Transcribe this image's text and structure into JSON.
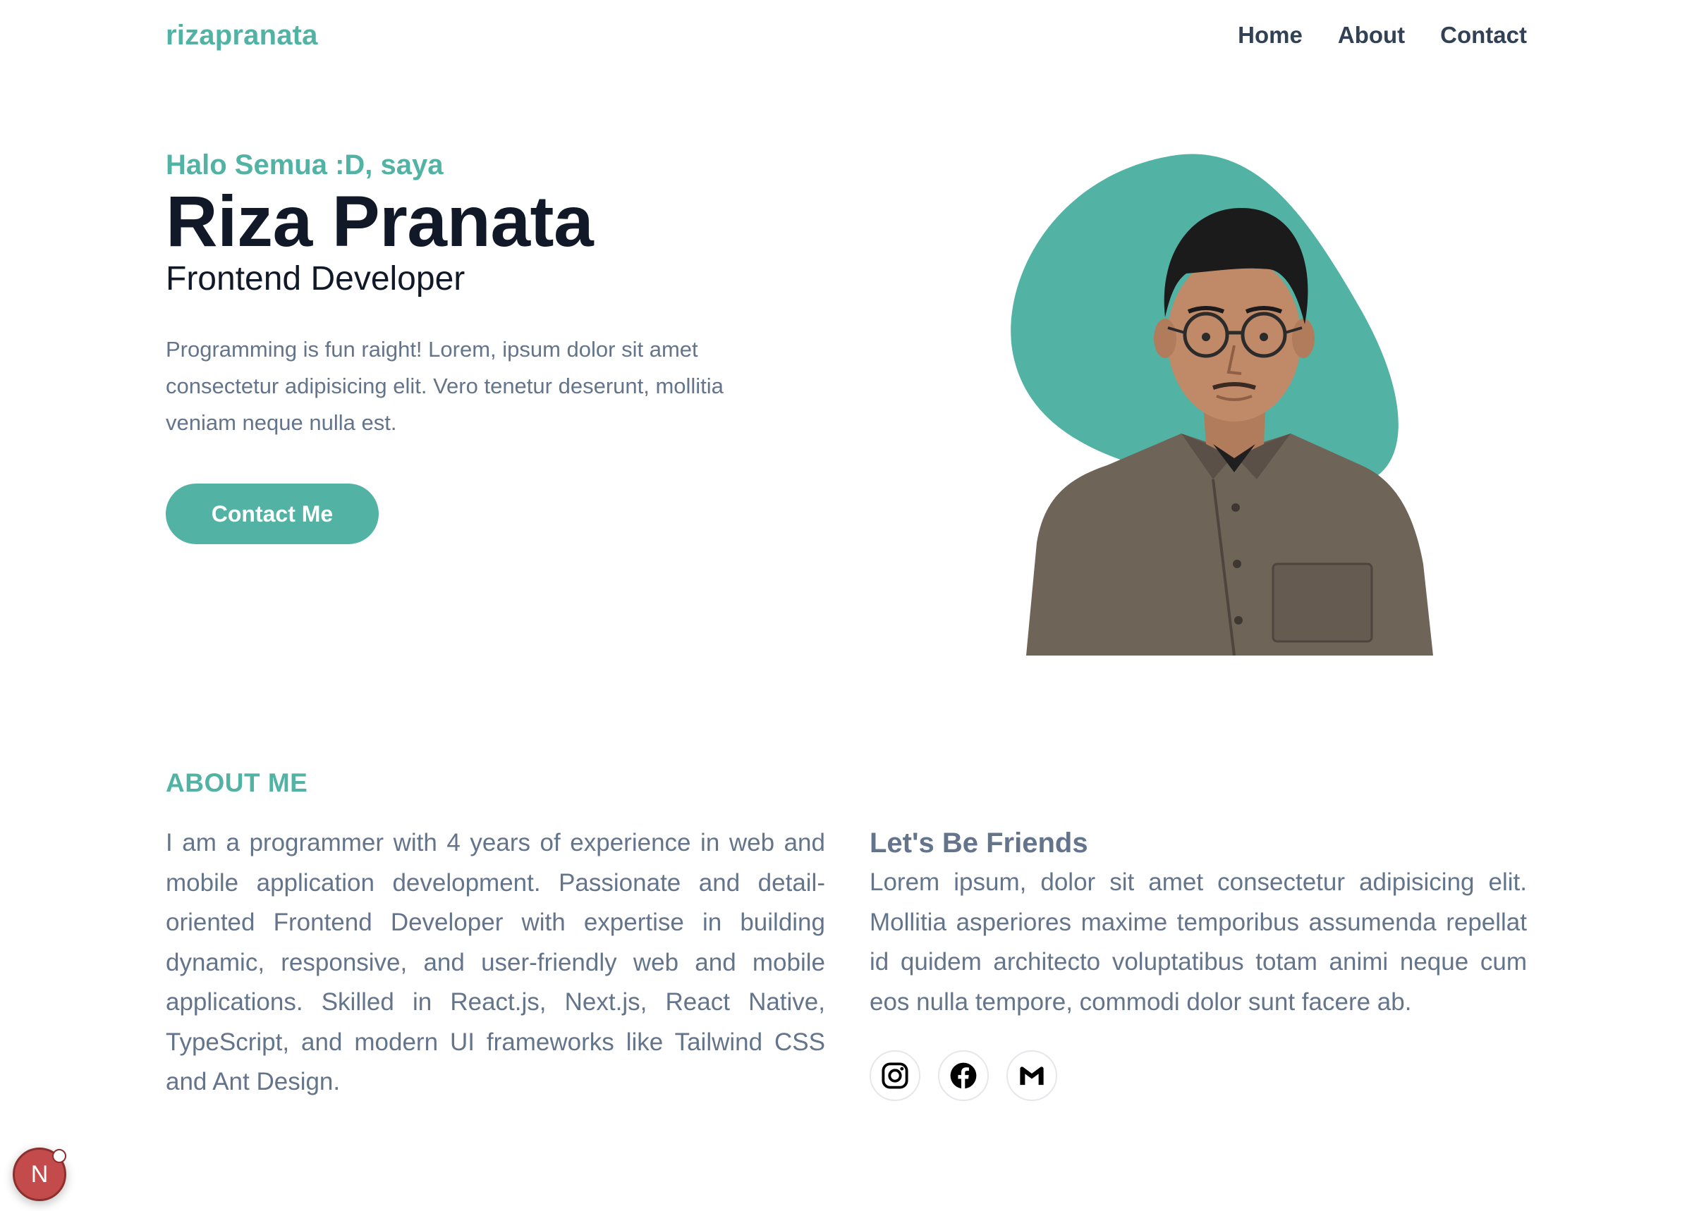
{
  "header": {
    "logo": "rizapranata",
    "nav": [
      "Home",
      "About",
      "Contact"
    ]
  },
  "hero": {
    "greeting": "Halo Semua :D, saya",
    "name": "Riza Pranata",
    "role": "Frontend Developer",
    "description": "Programming is fun raight! Lorem, ipsum dolor sit amet consectetur adipisicing elit. Vero tenetur deserunt, mollitia veniam neque nulla est.",
    "cta_label": "Contact Me"
  },
  "about": {
    "title": "ABOUT ME",
    "body": "I am a programmer with 4 years of experience in web and mobile application development. Passionate and detail-oriented Frontend Developer with expertise in building dynamic, responsive, and user-friendly web and mobile applications. Skilled in React.js, Next.js, React Native, TypeScript, and modern UI frameworks like Tailwind CSS and Ant Design."
  },
  "friends": {
    "title": "Let's Be Friends",
    "body": "Lorem ipsum, dolor sit amet consectetur adipisicing elit. Mollitia asperiores maxime temporibus assumenda repellat id quidem architecto voluptatibus totam animi neque cum eos nulla tempore, commodi dolor sunt facere ab.",
    "socials": [
      "instagram-icon",
      "facebook-icon",
      "gmail-icon"
    ]
  },
  "dev_badge": {
    "letter": "N"
  },
  "colors": {
    "accent": "#52b3a4",
    "heading": "#111827",
    "muted": "#64748b",
    "nav": "#334155"
  }
}
